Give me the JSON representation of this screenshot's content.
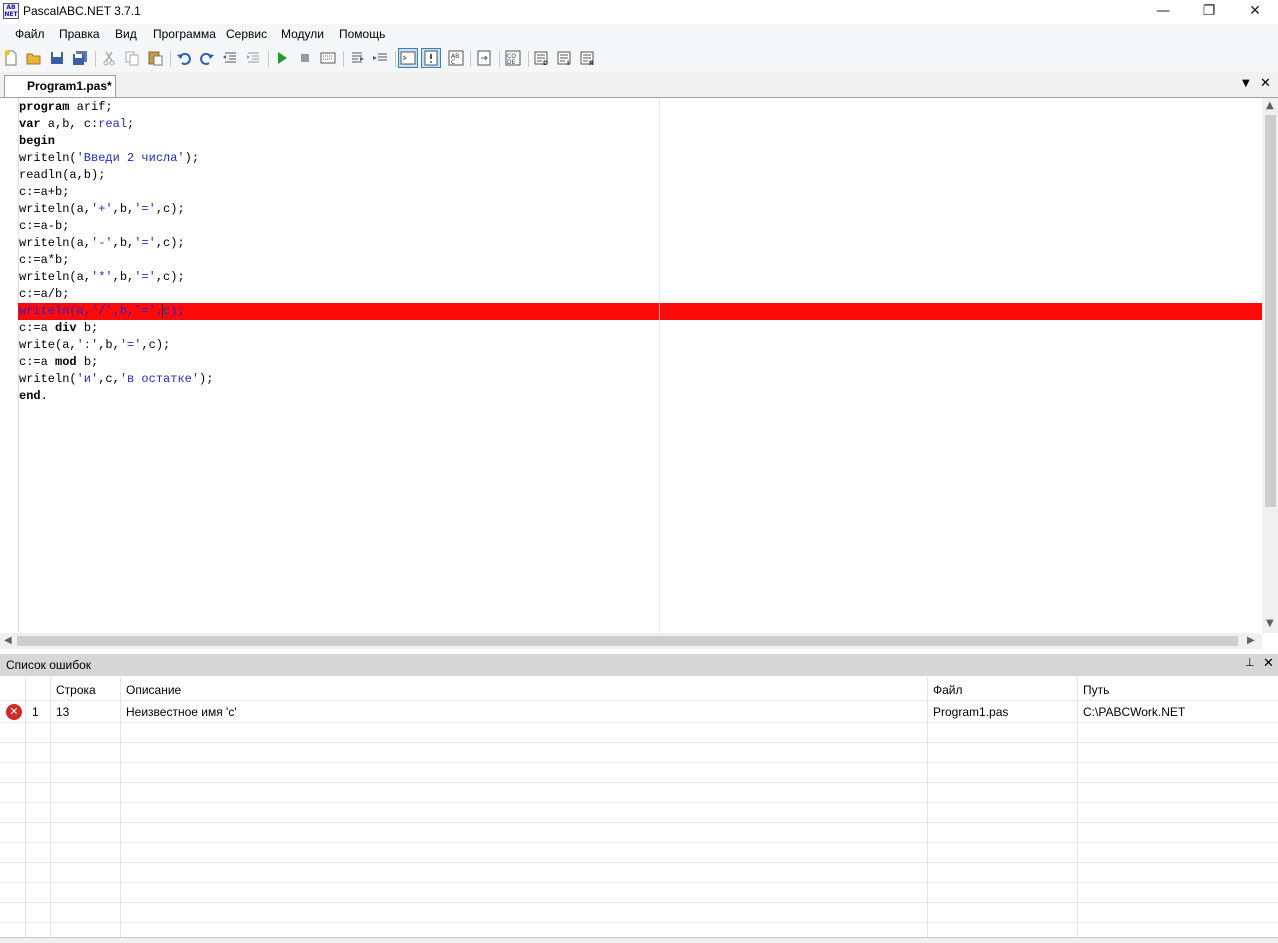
{
  "window": {
    "title": "PascalABC.NET 3.7.1",
    "logo_text": "AB\nNET",
    "minimize": "—",
    "restore": "❐",
    "close": "✕"
  },
  "menu": {
    "items": [
      "Файл",
      "Правка",
      "Вид",
      "Программа",
      "Сервис",
      "Модули",
      "Помощь"
    ]
  },
  "toolbar": {
    "icons": [
      "new-file-icon",
      "open-file-icon",
      "save-icon",
      "save-all-icon",
      "cut-icon",
      "copy-icon",
      "paste-icon",
      "undo-icon",
      "redo-icon",
      "outdent-icon",
      "indent-icon",
      "run-icon",
      "stop-icon",
      "compile-icon",
      "step-into-icon",
      "step-over-icon",
      "output-window-icon",
      "errors-window-icon",
      "format-code-icon",
      "go-to-definition-icon",
      "code-templates-icon",
      "debug-icon",
      "add-watch-icon",
      "run-to-cursor-icon"
    ]
  },
  "editor": {
    "tab_label": "Program1.pas*",
    "error_line_index": 12,
    "error_color": "#ff0a0a",
    "string_color": "#1f2bc8"
  },
  "error_panel": {
    "title": "Список ошибок",
    "pin": "📌",
    "close": "✕",
    "columns": [
      "Строка",
      "Описание",
      "Файл",
      "Путь"
    ],
    "rows": [
      {
        "num": "1",
        "line": "13",
        "description": "Неизвестное имя 'c'",
        "file": "Program1.pas",
        "path": "C:\\PABCWork.NET"
      }
    ]
  }
}
